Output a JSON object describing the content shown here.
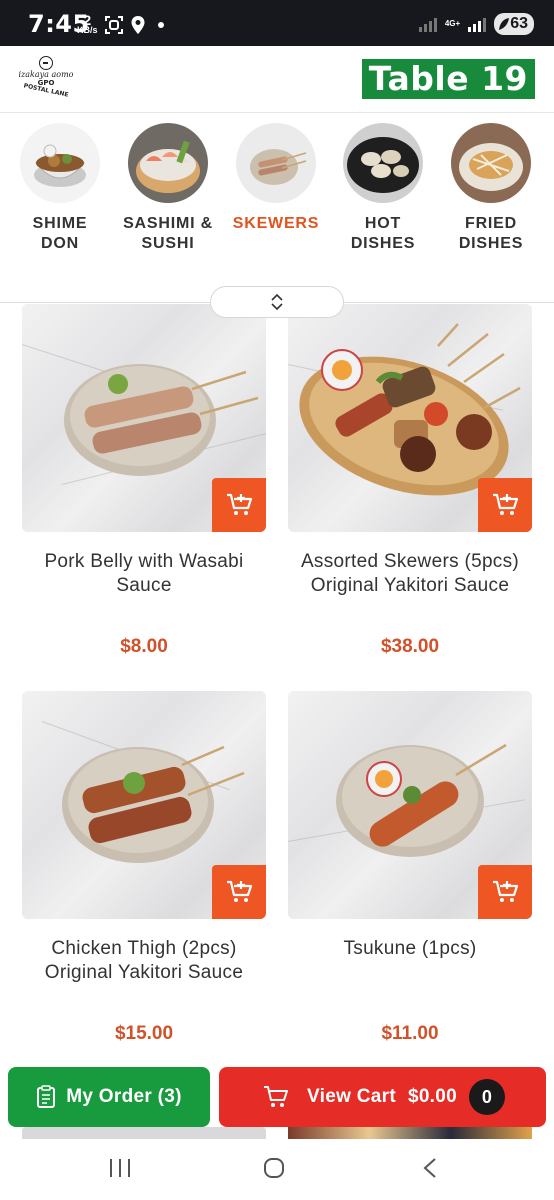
{
  "status_bar": {
    "time": "7:45",
    "net_speed": "2",
    "net_unit": "KB/s",
    "network_type": "4G+",
    "battery": "63"
  },
  "header": {
    "logo_lines": [
      "izakaya aomo",
      "GPO",
      "POSTAL LANE"
    ],
    "table_label": "Table 19"
  },
  "categories": [
    {
      "label_1": "SHIME",
      "label_2": "DON",
      "icon": "rice-bowl",
      "active": false
    },
    {
      "label_1": "SASHIMI &",
      "label_2": "SUSHI",
      "icon": "sashimi-platter",
      "active": false
    },
    {
      "label_1": "SKEWERS",
      "label_2": "",
      "icon": "skewers-plate",
      "active": true
    },
    {
      "label_1": "HOT",
      "label_2": "DISHES",
      "icon": "clams-pan",
      "active": false
    },
    {
      "label_1": "FRIED",
      "label_2": "DISHES",
      "icon": "fried-dish",
      "active": false
    }
  ],
  "products": [
    {
      "name": "Pork Belly with Wasabi Sauce",
      "price": "$8.00",
      "icon": "pork-belly-skewers"
    },
    {
      "name": "Assorted Skewers (5pcs) Original Yakitori Sauce",
      "price": "$38.00",
      "icon": "assorted-skewers"
    },
    {
      "name": "Chicken Thigh (2pcs) Original Yakitori Sauce",
      "price": "$15.00",
      "icon": "chicken-thigh-skewers"
    },
    {
      "name": "Tsukune (1pcs)",
      "price": "$11.00",
      "icon": "tsukune-skewer"
    }
  ],
  "actions": {
    "my_order_label": "My Order (3)",
    "view_cart_label": "View Cart",
    "cart_total": "$0.00",
    "cart_count": "0"
  },
  "colors": {
    "accent_orange": "#e0541f",
    "price_red": "#d0512a",
    "cart_button": "#ee5624",
    "my_order_green": "#189a3f",
    "view_cart_red": "#e52c26",
    "table_badge_green": "#178a3c"
  }
}
